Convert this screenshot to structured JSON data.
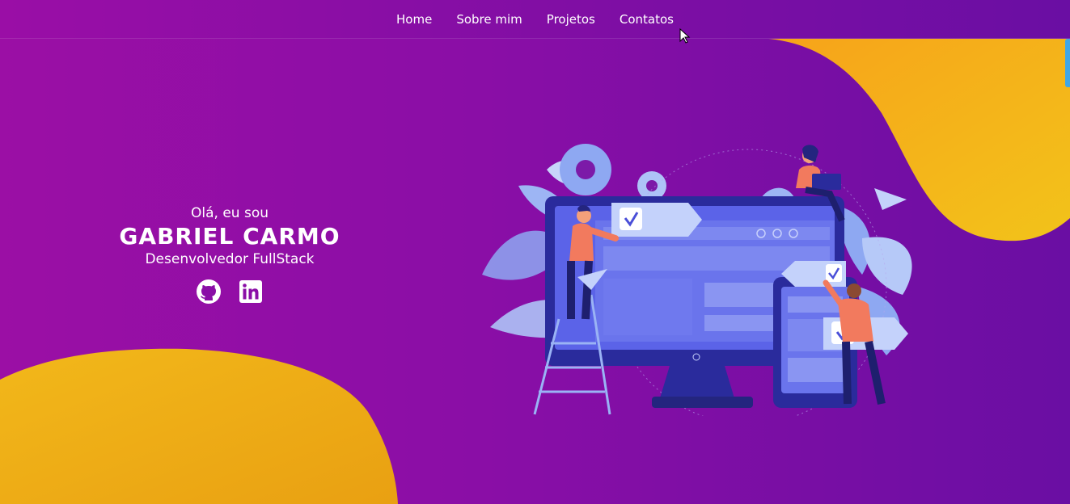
{
  "nav": {
    "items": [
      {
        "label": "Home"
      },
      {
        "label": "Sobre mim"
      },
      {
        "label": "Projetos"
      },
      {
        "label": "Contatos"
      }
    ]
  },
  "hero": {
    "greeting": "Olá, eu sou",
    "name": "GABRIEL CARMO",
    "role": "Desenvolvedor FullStack"
  },
  "social": {
    "icons": [
      "github-icon",
      "linkedin-icon"
    ]
  },
  "colors": {
    "bg_start": "#9b0fa5",
    "bg_end": "#6a0ea3",
    "accent_yellow": "#f0b818",
    "illustration_blue": "#5b63e8"
  }
}
